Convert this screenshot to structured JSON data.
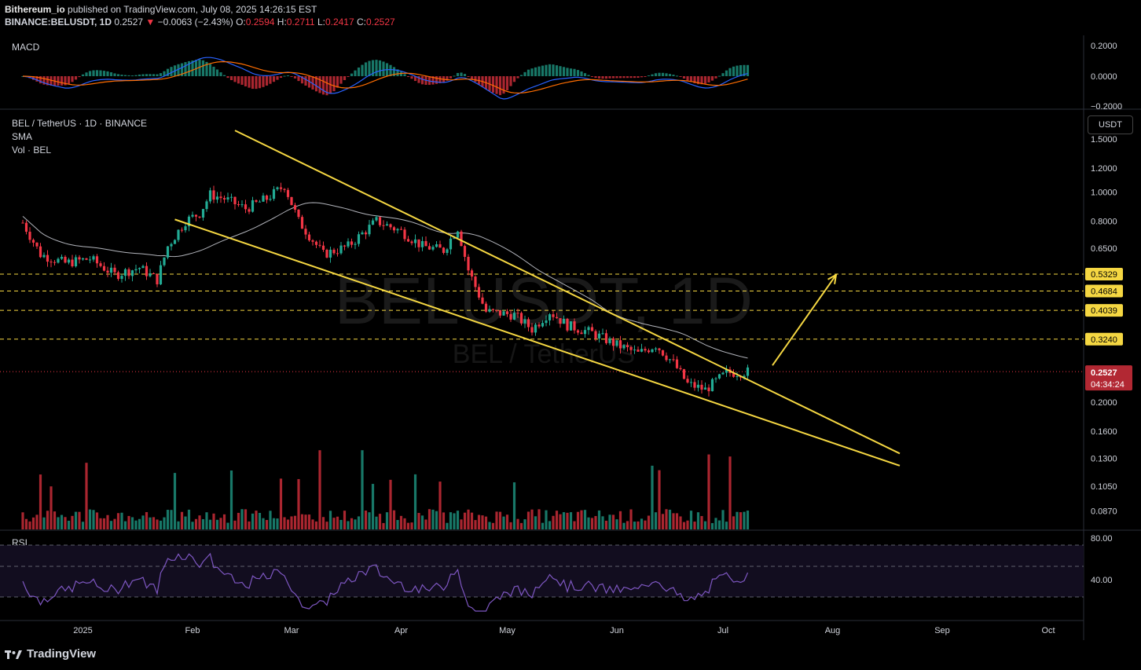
{
  "header": {
    "publisher": "Bithereum_io",
    "published_text": "published on TradingView.com, July 08, 2025 14:26:15 EST",
    "symbol": "BINANCE:BELUSDT, 1D",
    "last": "0.2527",
    "change_arrow": "▼",
    "change": "−0.0063 (−2.43%)",
    "o_label": "O:",
    "o": "0.2594",
    "h_label": "H:",
    "h": "0.2711",
    "l_label": "L:",
    "l": "0.2417",
    "c_label": "C:",
    "c": "0.2527"
  },
  "panes": {
    "macd_title": "MACD",
    "main_title": "BEL / TetherUS · 1D · BINANCE",
    "sma_label": "SMA",
    "vol_label": "Vol · BEL",
    "rsi_title": "RSI",
    "watermark_big": "BELUSDT, 1D",
    "watermark_small": "BEL / TetherUS"
  },
  "scale": {
    "currency_button": "USDT",
    "macd_ticks": [
      "0.2000",
      "0.0000",
      "−0.2000"
    ],
    "price_ticks": [
      "1.5000",
      "1.2000",
      "1.0000",
      "0.8000",
      "0.6500",
      "0.2000",
      "0.1600",
      "0.1300",
      "0.1050",
      "0.0870"
    ],
    "rsi_ticks": [
      "80.00",
      "40.00"
    ],
    "level_labels": [
      "0.5329",
      "0.4684",
      "0.4039",
      "0.3240"
    ],
    "current_price": "0.2527",
    "countdown": "04:34:24"
  },
  "time_axis": {
    "labels": [
      "2025",
      "Feb",
      "Mar",
      "Apr",
      "May",
      "Jun",
      "Jul",
      "Aug",
      "Sep",
      "Oct"
    ]
  },
  "footer": {
    "brand": "TradingView",
    "logo_icon": "tradingview-logo-icon"
  },
  "colors": {
    "up": "#22ab94",
    "down": "#f23645",
    "trendline": "#f5d742",
    "sma": "#d1d4dc",
    "rsi": "#7e57c2",
    "macd": "#2962ff",
    "signal": "#ff6d00"
  },
  "chart_data": {
    "type": "candlestick",
    "title": "BEL / TetherUS · 1D · BINANCE",
    "y_scale": "log",
    "ylim": [
      0.08,
      1.6
    ],
    "x_range": [
      "2024-12-13",
      "2025-10-20"
    ],
    "last_close": 0.2527,
    "ohlc_approx": [
      {
        "date": "2024-12-15",
        "close": 0.79
      },
      {
        "date": "2024-12-20",
        "close": 0.62
      },
      {
        "date": "2024-12-27",
        "close": 0.58
      },
      {
        "date": "2025-01-03",
        "close": 0.6
      },
      {
        "date": "2025-01-10",
        "close": 0.53
      },
      {
        "date": "2025-01-17",
        "close": 0.56
      },
      {
        "date": "2025-01-22",
        "close": 0.51
      },
      {
        "date": "2025-01-25",
        "close": 0.66
      },
      {
        "date": "2025-01-30",
        "close": 0.8
      },
      {
        "date": "2025-02-03",
        "close": 0.85
      },
      {
        "date": "2025-02-06",
        "close": 0.98
      },
      {
        "date": "2025-02-10",
        "close": 0.95
      },
      {
        "date": "2025-02-16",
        "close": 0.88
      },
      {
        "date": "2025-02-22",
        "close": 0.95
      },
      {
        "date": "2025-02-27",
        "close": 1.05
      },
      {
        "date": "2025-03-03",
        "close": 0.8
      },
      {
        "date": "2025-03-10",
        "close": 0.62
      },
      {
        "date": "2025-03-17",
        "close": 0.66
      },
      {
        "date": "2025-03-25",
        "close": 0.8
      },
      {
        "date": "2025-04-01",
        "close": 0.74
      },
      {
        "date": "2025-04-07",
        "close": 0.66
      },
      {
        "date": "2025-04-13",
        "close": 0.64
      },
      {
        "date": "2025-04-17",
        "close": 0.76
      },
      {
        "date": "2025-04-20",
        "close": 0.55
      },
      {
        "date": "2025-04-25",
        "close": 0.4
      },
      {
        "date": "2025-05-03",
        "close": 0.39
      },
      {
        "date": "2025-05-08",
        "close": 0.35
      },
      {
        "date": "2025-05-13",
        "close": 0.4
      },
      {
        "date": "2025-05-18",
        "close": 0.36
      },
      {
        "date": "2025-05-25",
        "close": 0.34
      },
      {
        "date": "2025-06-01",
        "close": 0.31
      },
      {
        "date": "2025-06-07",
        "close": 0.29
      },
      {
        "date": "2025-06-12",
        "close": 0.31
      },
      {
        "date": "2025-06-17",
        "close": 0.27
      },
      {
        "date": "2025-06-21",
        "close": 0.23
      },
      {
        "date": "2025-06-26",
        "close": 0.22
      },
      {
        "date": "2025-07-02",
        "close": 0.25
      },
      {
        "date": "2025-07-08",
        "close": 0.2527
      }
    ],
    "levels": [
      0.5329,
      0.4684,
      0.4039,
      0.324
    ],
    "trendlines": [
      {
        "name": "upper",
        "from": {
          "date": "2025-02-13",
          "price": 1.6
        },
        "to": {
          "date": "2025-08-20",
          "price": 0.135
        }
      },
      {
        "name": "lower",
        "from": {
          "date": "2025-01-27",
          "price": 0.81
        },
        "to": {
          "date": "2025-08-20",
          "price": 0.123
        }
      }
    ],
    "projection_arrow": {
      "from": {
        "date": "2025-07-15",
        "price": 0.265
      },
      "to": {
        "date": "2025-08-02",
        "price": 0.53
      }
    },
    "indicators": [
      "MACD",
      "SMA",
      "Vol",
      "RSI"
    ],
    "rsi_ylim": [
      0,
      100
    ],
    "macd_ylim": [
      -0.25,
      0.25
    ],
    "grid": false
  }
}
